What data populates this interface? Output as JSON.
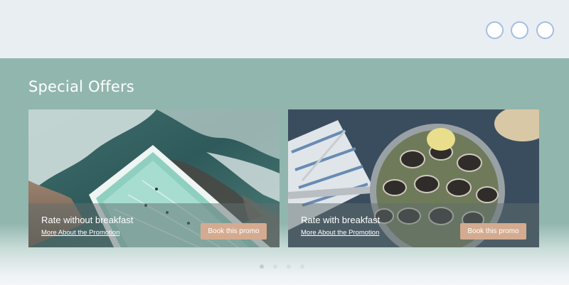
{
  "header": {
    "buttons": [
      {
        "name": "circle-button-1"
      },
      {
        "name": "circle-button-2"
      },
      {
        "name": "circle-button-3"
      }
    ]
  },
  "offers": {
    "title": "Special Offers",
    "cards": [
      {
        "title": "Rate without breakfast",
        "link": "More About the Promotion",
        "button": "Book this promo",
        "image": "pool-by-sea-aerial-photo"
      },
      {
        "title": "Rate with breakfast",
        "link": "More About the Promotion",
        "button": "Book this promo",
        "image": "clams-pan-photo"
      }
    ]
  },
  "pagination": {
    "count": 4,
    "active": 1
  },
  "colors": {
    "section_bg": "#91b6ae",
    "button_bg": "#d4ab90",
    "header_bg": "#e9eef2",
    "circle_border": "#a7bde3"
  }
}
